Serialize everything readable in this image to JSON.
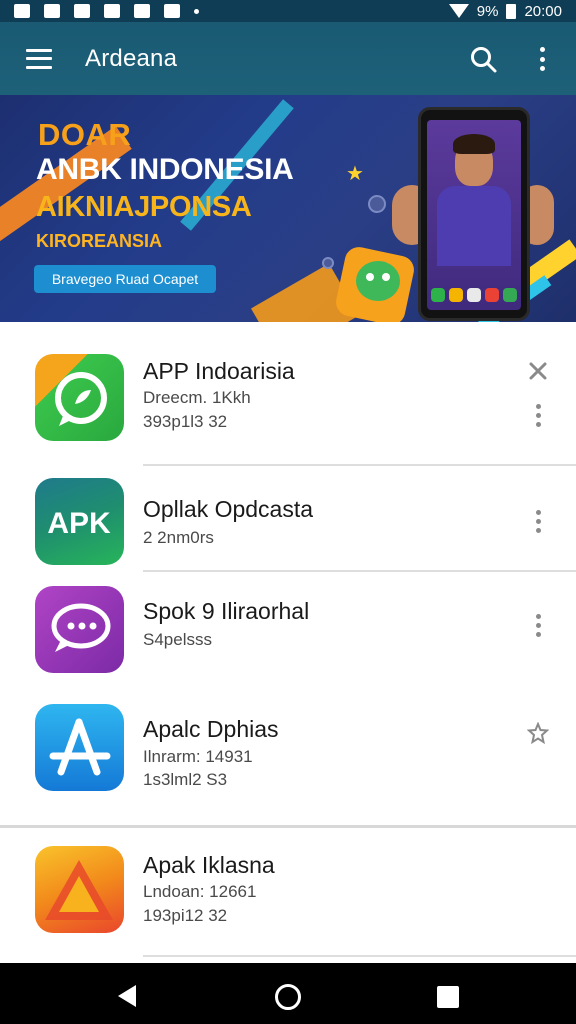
{
  "status_bar": {
    "battery": "9%",
    "time": "20:00"
  },
  "app_bar": {
    "title": "Ardeana",
    "icons": [
      "menu-icon",
      "search-icon",
      "more-vert-icon"
    ]
  },
  "banner": {
    "line1": "DOAR",
    "line2": "ANBK INDONESIA",
    "line3": "AIKNIAJPONSA",
    "line4": "KIROREANSIA",
    "button": "Bravegeo Ruad Ocapet",
    "colors": {
      "bg": "#233c8a",
      "orange": "#f7a11a",
      "button": "#1d8fd0"
    }
  },
  "apps": [
    {
      "name": "APP Indoarisia",
      "meta1": "Dreecm. 1Kkh",
      "meta2": "393p1l3 32",
      "action": "close-icon",
      "icon": "whatsapp-like-icon"
    },
    {
      "name": "Opllak Opdcasta",
      "meta1": "2 2nm0rs",
      "meta2": "",
      "action": "more-vert-icon",
      "icon": "apk-icon"
    },
    {
      "name": "Spok 9 Iliraorhal",
      "meta1": "S4pelsss",
      "meta2": "",
      "action": "more-vert-icon",
      "icon": "chat-bubble-icon"
    },
    {
      "name": "Apalc Dphias",
      "meta1": "Ilnrarm: 14931",
      "meta2": "1s3lml2 S3",
      "action": "pin-icon",
      "icon": "app-store-icon"
    },
    {
      "name": "Apak Iklasna",
      "meta1": "Lndoan: 12661",
      "meta2": "193pi12 32",
      "action": "",
      "icon": "orange-triangle-icon"
    }
  ],
  "nav_bar": {
    "icons": [
      "back-icon",
      "home-icon",
      "recents-icon"
    ]
  }
}
